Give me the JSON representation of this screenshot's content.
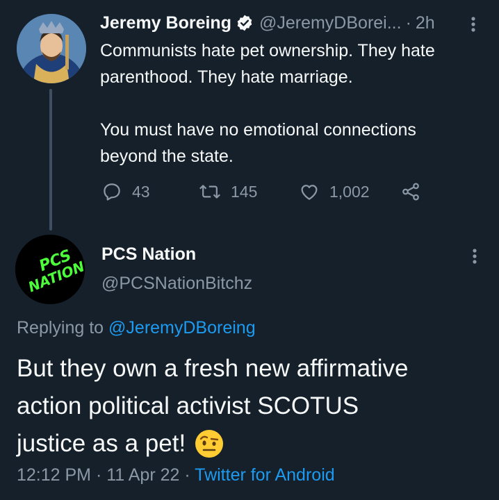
{
  "parent_tweet": {
    "display_name": "Jeremy Boreing",
    "handle": "@JeremyDBorei...",
    "separator": "·",
    "time": "2h",
    "text_lines": [
      "Communists hate pet ownership. They hate",
      "parenthood. They hate marriage.",
      "You must have no emotional connections",
      "beyond the state."
    ],
    "actions": {
      "replies": "43",
      "retweets": "145",
      "likes": "1,002"
    }
  },
  "reply_tweet": {
    "display_name": "PCS Nation",
    "handle": "@PCSNationBitchz",
    "avatar_text_lines": [
      "PCS",
      "NATION"
    ],
    "replying_prefix": "Replying to ",
    "replying_handle": "@JeremyDBoreing",
    "text_lines": [
      "But they own a fresh new affirmative",
      "action political activist SCOTUS",
      "justice as a pet!"
    ],
    "meta_time": "12:12 PM · 11 Apr 22 · ",
    "meta_source": "Twitter for Android"
  },
  "colors": {
    "background": "#15202b",
    "text": "#f7f9f9",
    "secondary": "#8b98a5",
    "accent": "#1d9bf0",
    "pcs_green": "#4cff3a"
  },
  "icons": [
    "verified-badge-icon",
    "more-options-icon",
    "reply-icon",
    "retweet-icon",
    "like-icon",
    "share-icon",
    "raised-eyebrow-emoji-icon"
  ]
}
